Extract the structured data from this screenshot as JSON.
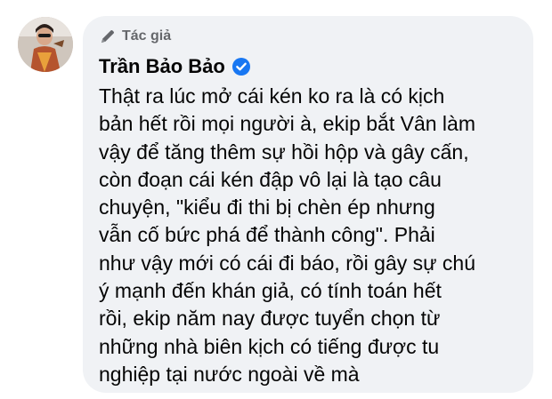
{
  "comment": {
    "badge_label": "Tác giả",
    "badge_icon": "pen-icon",
    "author_name": "Trần Bảo Bảo",
    "verified_icon": "verified-badge-icon",
    "verified_color": "#1877f2",
    "bubble_color": "#f0f2f5",
    "lines": [
      "Thật ra lúc mở cái kén ko ra là có kịch",
      "bản hết rồi mọi người à, ekip bắt Vân làm",
      "vậy để tăng thêm sự hồi hộp và gây cấn,",
      "còn đoạn cái kén đập vô lại là tạo câu",
      "chuyện, \"kiểu đi thi bị chèn ép nhưng",
      "vẫn cố bức phá để thành công\". Phải",
      "như vậy mới có cái đi báo, rồi gây sự chú",
      "ý mạnh đến khán giả, có tính toán hết",
      "rồi, ekip năm nay được tuyển chọn từ",
      "những nhà biên kịch có tiếng được tu",
      "nghiệp tại nước ngoài về mà"
    ]
  }
}
